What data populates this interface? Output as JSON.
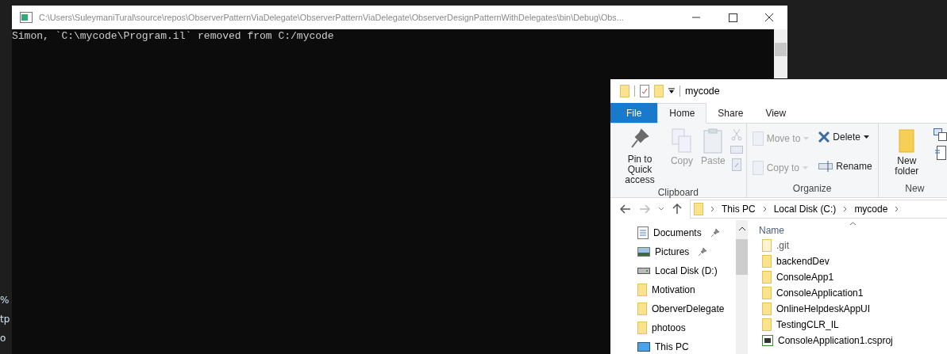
{
  "background_fragments": [
    "%",
    "tp",
    "o"
  ],
  "console": {
    "title": "C:\\Users\\SuleymaniTural\\source\\repos\\ObserverPatternViaDelegate\\ObserverPatternViaDelegate\\ObserverDesignPatternWithDelegates\\bin\\Debug\\Obs...",
    "output": "Simon, `C:\\mycode\\Program.il` removed from C:/mycode"
  },
  "explorer": {
    "title": "mycode",
    "tabs": [
      {
        "label": "File",
        "kind": "file",
        "selected": false
      },
      {
        "label": "Home",
        "kind": "tab",
        "selected": true
      },
      {
        "label": "Share",
        "kind": "tab",
        "selected": false
      },
      {
        "label": "View",
        "kind": "tab",
        "selected": false
      }
    ],
    "ribbon_groups": [
      {
        "label": "Clipboard",
        "commands": [
          {
            "label": "Pin to Quick access",
            "kind": "pin",
            "disabled": false
          },
          {
            "label": "Copy",
            "kind": "copy",
            "disabled": true
          },
          {
            "label": "Paste",
            "kind": "paste",
            "disabled": true
          },
          {
            "kind": "smallstack",
            "disabled": true
          }
        ]
      },
      {
        "label": "Organize",
        "commands": [
          {
            "label": "Move to",
            "kind": "moveto",
            "disabled": true
          },
          {
            "label": "Copy to",
            "kind": "copyto",
            "disabled": true
          },
          {
            "label": "Delete",
            "kind": "delete",
            "disabled": false
          },
          {
            "label": "Rename",
            "kind": "rename",
            "disabled": false
          }
        ]
      },
      {
        "label": "New",
        "commands": [
          {
            "label": "New folder",
            "kind": "newfolder",
            "disabled": false
          }
        ]
      }
    ],
    "breadcrumb": [
      "This PC",
      "Local Disk (C:)",
      "mycode"
    ],
    "nav_items": [
      {
        "label": "Documents",
        "kind": "documents",
        "pinned": true
      },
      {
        "label": "Pictures",
        "kind": "pictures",
        "pinned": true
      },
      {
        "label": "Local Disk (D:)",
        "kind": "drive",
        "pinned": false
      },
      {
        "label": "Motivation",
        "kind": "folder",
        "pinned": false
      },
      {
        "label": "OberverDelegate",
        "kind": "folder",
        "pinned": false
      },
      {
        "label": "photoos",
        "kind": "folder",
        "pinned": false
      },
      {
        "label": "This PC",
        "kind": "pc",
        "pinned": false
      }
    ],
    "column_header": "Name",
    "files": [
      {
        "name": ".git",
        "kind": "hidden"
      },
      {
        "name": "backendDev",
        "kind": "folder"
      },
      {
        "name": "ConsoleApp1",
        "kind": "folder"
      },
      {
        "name": "ConsoleApplication1",
        "kind": "folder"
      },
      {
        "name": "OnlineHelpdeskAppUI",
        "kind": "folder"
      },
      {
        "name": "TestingCLR_IL",
        "kind": "folder"
      },
      {
        "name": "ConsoleApplication1.csproj",
        "kind": "csproj"
      }
    ]
  }
}
